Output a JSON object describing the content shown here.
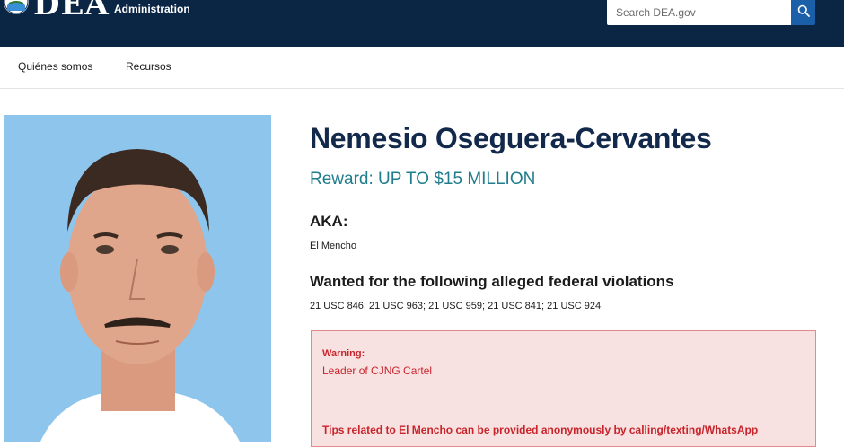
{
  "header": {
    "logo_text": "DEA",
    "logo_subtitle": "Administration",
    "search_placeholder": "Search DEA.gov",
    "colors": {
      "background": "#0b2545",
      "search_button": "#1a5fa8"
    },
    "icons": {
      "seal": "dea-seal-icon",
      "search": "magnifier-icon"
    }
  },
  "nav": {
    "items": [
      {
        "label": "Quiénes somos"
      },
      {
        "label": "Recursos"
      }
    ]
  },
  "profile": {
    "name": "Nemesio Oseguera-Cervantes",
    "reward": "Reward: UP TO $15 MILLION",
    "aka_heading": "AKA:",
    "aka_value": "El Mencho",
    "violations_heading": "Wanted for the following alleged federal violations",
    "violations_value": "21 USC 846; 21 USC 963; 21 USC 959; 21 USC 841; 21 USC 924",
    "colors": {
      "name": "#13294b",
      "reward": "#1f7d8c"
    }
  },
  "warning": {
    "label": "Warning:",
    "text": "Leader of CJNG Cartel",
    "tips": "Tips related to El Mencho can be provided anonymously by calling/texting/WhatsApp",
    "colors": {
      "text": "#c8242b",
      "background": "#f8e1e1",
      "border": "#e48a8a"
    }
  }
}
